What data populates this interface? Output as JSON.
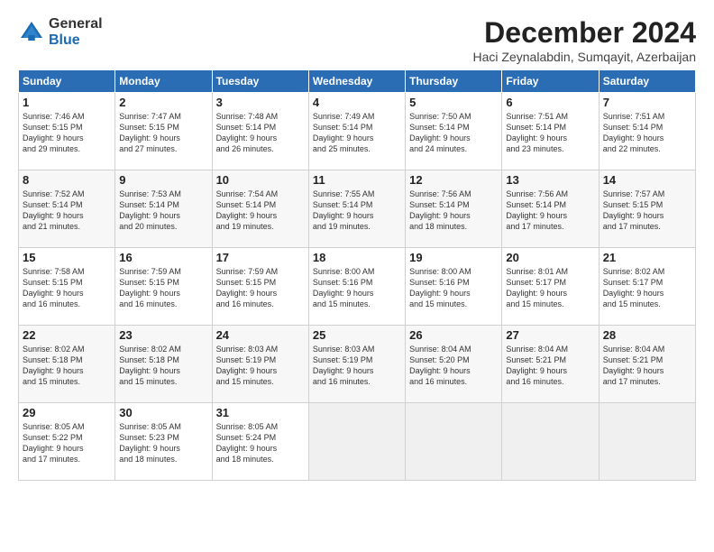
{
  "logo": {
    "general": "General",
    "blue": "Blue"
  },
  "header": {
    "month": "December 2024",
    "location": "Haci Zeynalabdin, Sumqayit, Azerbaijan"
  },
  "weekdays": [
    "Sunday",
    "Monday",
    "Tuesday",
    "Wednesday",
    "Thursday",
    "Friday",
    "Saturday"
  ],
  "weeks": [
    [
      {
        "day": "1",
        "info": "Sunrise: 7:46 AM\nSunset: 5:15 PM\nDaylight: 9 hours\nand 29 minutes."
      },
      {
        "day": "2",
        "info": "Sunrise: 7:47 AM\nSunset: 5:15 PM\nDaylight: 9 hours\nand 27 minutes."
      },
      {
        "day": "3",
        "info": "Sunrise: 7:48 AM\nSunset: 5:14 PM\nDaylight: 9 hours\nand 26 minutes."
      },
      {
        "day": "4",
        "info": "Sunrise: 7:49 AM\nSunset: 5:14 PM\nDaylight: 9 hours\nand 25 minutes."
      },
      {
        "day": "5",
        "info": "Sunrise: 7:50 AM\nSunset: 5:14 PM\nDaylight: 9 hours\nand 24 minutes."
      },
      {
        "day": "6",
        "info": "Sunrise: 7:51 AM\nSunset: 5:14 PM\nDaylight: 9 hours\nand 23 minutes."
      },
      {
        "day": "7",
        "info": "Sunrise: 7:51 AM\nSunset: 5:14 PM\nDaylight: 9 hours\nand 22 minutes."
      }
    ],
    [
      {
        "day": "8",
        "info": "Sunrise: 7:52 AM\nSunset: 5:14 PM\nDaylight: 9 hours\nand 21 minutes."
      },
      {
        "day": "9",
        "info": "Sunrise: 7:53 AM\nSunset: 5:14 PM\nDaylight: 9 hours\nand 20 minutes."
      },
      {
        "day": "10",
        "info": "Sunrise: 7:54 AM\nSunset: 5:14 PM\nDaylight: 9 hours\nand 19 minutes."
      },
      {
        "day": "11",
        "info": "Sunrise: 7:55 AM\nSunset: 5:14 PM\nDaylight: 9 hours\nand 19 minutes."
      },
      {
        "day": "12",
        "info": "Sunrise: 7:56 AM\nSunset: 5:14 PM\nDaylight: 9 hours\nand 18 minutes."
      },
      {
        "day": "13",
        "info": "Sunrise: 7:56 AM\nSunset: 5:14 PM\nDaylight: 9 hours\nand 17 minutes."
      },
      {
        "day": "14",
        "info": "Sunrise: 7:57 AM\nSunset: 5:15 PM\nDaylight: 9 hours\nand 17 minutes."
      }
    ],
    [
      {
        "day": "15",
        "info": "Sunrise: 7:58 AM\nSunset: 5:15 PM\nDaylight: 9 hours\nand 16 minutes."
      },
      {
        "day": "16",
        "info": "Sunrise: 7:59 AM\nSunset: 5:15 PM\nDaylight: 9 hours\nand 16 minutes."
      },
      {
        "day": "17",
        "info": "Sunrise: 7:59 AM\nSunset: 5:15 PM\nDaylight: 9 hours\nand 16 minutes."
      },
      {
        "day": "18",
        "info": "Sunrise: 8:00 AM\nSunset: 5:16 PM\nDaylight: 9 hours\nand 15 minutes."
      },
      {
        "day": "19",
        "info": "Sunrise: 8:00 AM\nSunset: 5:16 PM\nDaylight: 9 hours\nand 15 minutes."
      },
      {
        "day": "20",
        "info": "Sunrise: 8:01 AM\nSunset: 5:17 PM\nDaylight: 9 hours\nand 15 minutes."
      },
      {
        "day": "21",
        "info": "Sunrise: 8:02 AM\nSunset: 5:17 PM\nDaylight: 9 hours\nand 15 minutes."
      }
    ],
    [
      {
        "day": "22",
        "info": "Sunrise: 8:02 AM\nSunset: 5:18 PM\nDaylight: 9 hours\nand 15 minutes."
      },
      {
        "day": "23",
        "info": "Sunrise: 8:02 AM\nSunset: 5:18 PM\nDaylight: 9 hours\nand 15 minutes."
      },
      {
        "day": "24",
        "info": "Sunrise: 8:03 AM\nSunset: 5:19 PM\nDaylight: 9 hours\nand 15 minutes."
      },
      {
        "day": "25",
        "info": "Sunrise: 8:03 AM\nSunset: 5:19 PM\nDaylight: 9 hours\nand 16 minutes."
      },
      {
        "day": "26",
        "info": "Sunrise: 8:04 AM\nSunset: 5:20 PM\nDaylight: 9 hours\nand 16 minutes."
      },
      {
        "day": "27",
        "info": "Sunrise: 8:04 AM\nSunset: 5:21 PM\nDaylight: 9 hours\nand 16 minutes."
      },
      {
        "day": "28",
        "info": "Sunrise: 8:04 AM\nSunset: 5:21 PM\nDaylight: 9 hours\nand 17 minutes."
      }
    ],
    [
      {
        "day": "29",
        "info": "Sunrise: 8:05 AM\nSunset: 5:22 PM\nDaylight: 9 hours\nand 17 minutes."
      },
      {
        "day": "30",
        "info": "Sunrise: 8:05 AM\nSunset: 5:23 PM\nDaylight: 9 hours\nand 18 minutes."
      },
      {
        "day": "31",
        "info": "Sunrise: 8:05 AM\nSunset: 5:24 PM\nDaylight: 9 hours\nand 18 minutes."
      },
      null,
      null,
      null,
      null
    ]
  ]
}
